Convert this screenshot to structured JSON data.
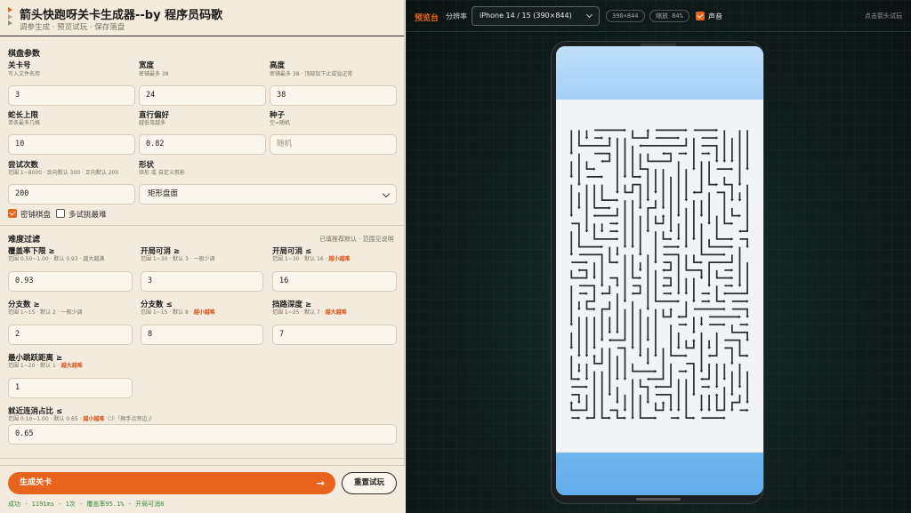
{
  "header": {
    "title": "箭头快跑呀关卡生成器--by 程序员码歌",
    "subtitle": "调参生成 · 预览试玩 · 保存落盘"
  },
  "board": {
    "section_title": "棋盘参数",
    "level_no": {
      "label": "关卡号",
      "hint": "写入文件名用",
      "value": "3"
    },
    "width": {
      "label": "宽度",
      "hint": "密铺最多 38",
      "value": "24"
    },
    "height": {
      "label": "高度",
      "hint": "密铺最多 38 · 顶部加下止或溢疋常",
      "value": "38"
    },
    "snake_max": {
      "label": "蛇长上限",
      "hint": "单条最多几格",
      "value": "10"
    },
    "straight_bias": {
      "label": "直行偏好",
      "hint": "越低弯越多",
      "value": "0.82"
    },
    "seed": {
      "label": "种子",
      "hint": "空=随机",
      "placeholder": "随机"
    },
    "attempts": {
      "label": "尝试次数",
      "hint": "范围 1~8000 · 反向默认 300 · 正向默认 200",
      "value": "200"
    },
    "shape": {
      "label": "形状",
      "hint": "矩形 或 自定义剪影",
      "value": "矩形盘面"
    },
    "dense_label": "密铺棋盘",
    "multi_label": "多试挑最难"
  },
  "filters": {
    "section_title": "难度过滤",
    "section_note": "已填推荐默认 · 范围见说明",
    "coverage": {
      "label": "覆盖率下限 ≥",
      "hint": "范围 0.50~1.00 · 默认 0.93 · 越大越满",
      "value": "0.93"
    },
    "open_min": {
      "label": "开局可消 ≥",
      "hint": "范围 1~30 · 默认 3 · 一般少调",
      "value": "3"
    },
    "open_max": {
      "label": "开局可消 ≤",
      "hint_pre": "范围 1~30 · 默认 16 · ",
      "hint_hot": "越小越难",
      "value": "16"
    },
    "branch_min": {
      "label": "分支数 ≥",
      "hint": "范围 1~15 · 默认 2 · 一般少调",
      "value": "2"
    },
    "branch_max": {
      "label": "分支数 ≤",
      "hint_pre": "范围 1~15 · 默认 8 · ",
      "hint_hot": "越小越难",
      "value": "8"
    },
    "block_depth": {
      "label": "挡路深度 ≥",
      "hint_pre": "范围 1~25 · 默认 7 · ",
      "hint_hot": "越大越难",
      "value": "7"
    },
    "jump_min": {
      "label": "最小跳跃距离 ≥",
      "hint_pre": "范围 1~20 · 默认 1 · ",
      "hint_hot": "越大越难",
      "value": "1"
    },
    "near_ratio": {
      "label": "就近连消占比 ≤",
      "hint_pre": "范围 0.10~1.00 · 默认 0.65 · ",
      "hint_hot": "越小越难",
      "hint_post": "（少「顺手点旁边」）",
      "value": "0.65"
    }
  },
  "footer": {
    "generate_label": "生成关卡",
    "generate_arrow": "→",
    "reset_label": "重置试玩",
    "status": "成功 · 1191ms · 1次 · 覆盖率95.1% · 开局可消8"
  },
  "preview": {
    "brand": "预览台",
    "resolution_label": "分辨率",
    "device": "iPhone 14 / 15 (390×844)",
    "size_pill": "390×844",
    "scale_pill": "缩放 84%",
    "sound_label": "声音",
    "tip": "点击箭头试玩"
  },
  "colors": {
    "accent": "#e8641d",
    "arrow": "#2b2d33"
  },
  "maze_grid": {
    "cols": 24,
    "rows": 38
  }
}
